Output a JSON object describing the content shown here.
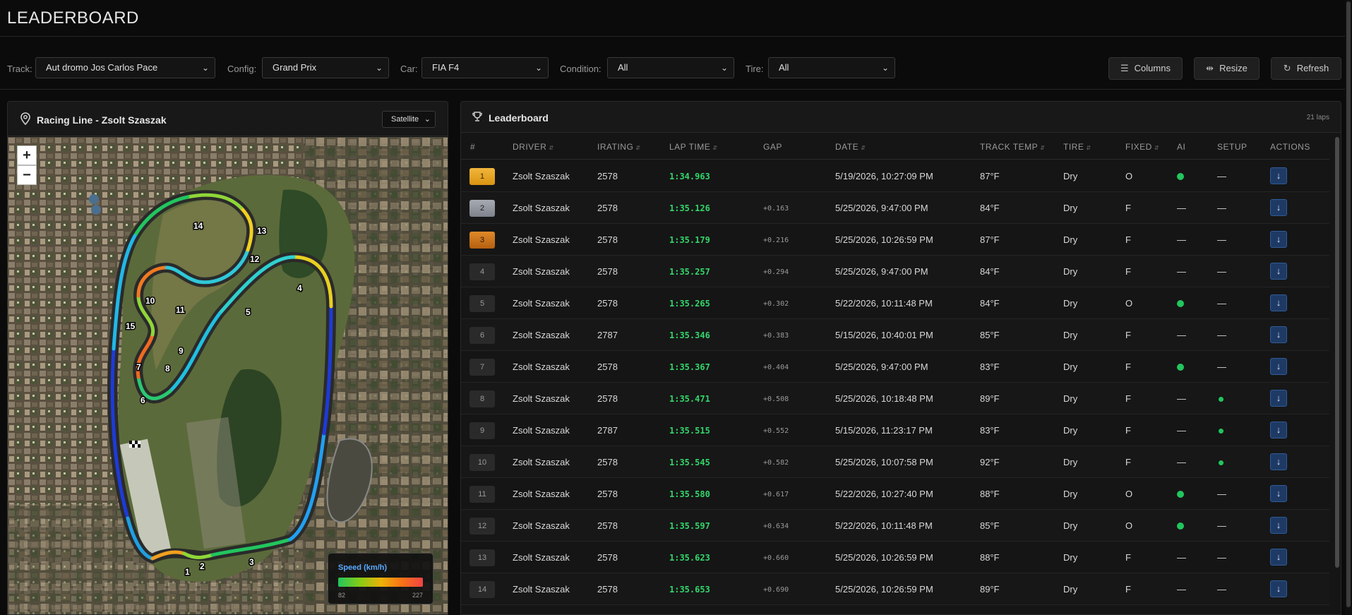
{
  "header": {
    "title": "LEADERBOARD"
  },
  "filters": {
    "track_label": "Track:",
    "track_value": "Aut dromo Jos Carlos Pace",
    "config_label": "Config:",
    "config_value": "Grand Prix",
    "car_label": "Car:",
    "car_value": "FIA F4",
    "condition_label": "Condition:",
    "condition_value": "All",
    "tire_label": "Tire:",
    "tire_value": "All"
  },
  "toolbar": {
    "columns": "Columns",
    "resize": "Resize",
    "refresh": "Refresh"
  },
  "map": {
    "title": "Racing Line - Zsolt Szaszak",
    "mode": "Satellite",
    "zoom_in": "+",
    "zoom_out": "−",
    "legend_title": "Speed (km/h)",
    "legend_min": "82",
    "legend_max": "227",
    "turns": [
      "1",
      "2",
      "3",
      "4",
      "5",
      "6",
      "7",
      "8",
      "9",
      "10",
      "11",
      "12",
      "13",
      "14",
      "15"
    ]
  },
  "leaderboard": {
    "title": "Leaderboard",
    "count": "21 laps",
    "columns": [
      "#",
      "DRIVER",
      "IRATING",
      "LAP TIME",
      "GAP",
      "DATE",
      "TRACK TEMP",
      "TIRE",
      "FIXED",
      "AI",
      "SETUP",
      "ACTIONS"
    ],
    "rows": [
      {
        "pos": "1",
        "driver": "Zsolt Szaszak",
        "irating": "2578",
        "lap": "1:34.963",
        "gap": "",
        "date": "5/19/2026, 10:27:09 PM",
        "temp": "87°F",
        "tire": "Dry",
        "fixed": "O",
        "ai": true,
        "setup": false
      },
      {
        "pos": "2",
        "driver": "Zsolt Szaszak",
        "irating": "2578",
        "lap": "1:35.126",
        "gap": "+0.163",
        "date": "5/25/2026, 9:47:00 PM",
        "temp": "84°F",
        "tire": "Dry",
        "fixed": "F",
        "ai": false,
        "setup": false
      },
      {
        "pos": "3",
        "driver": "Zsolt Szaszak",
        "irating": "2578",
        "lap": "1:35.179",
        "gap": "+0.216",
        "date": "5/25/2026, 10:26:59 PM",
        "temp": "87°F",
        "tire": "Dry",
        "fixed": "F",
        "ai": false,
        "setup": false
      },
      {
        "pos": "4",
        "driver": "Zsolt Szaszak",
        "irating": "2578",
        "lap": "1:35.257",
        "gap": "+0.294",
        "date": "5/25/2026, 9:47:00 PM",
        "temp": "84°F",
        "tire": "Dry",
        "fixed": "F",
        "ai": false,
        "setup": false
      },
      {
        "pos": "5",
        "driver": "Zsolt Szaszak",
        "irating": "2578",
        "lap": "1:35.265",
        "gap": "+0.302",
        "date": "5/22/2026, 10:11:48 PM",
        "temp": "84°F",
        "tire": "Dry",
        "fixed": "O",
        "ai": true,
        "setup": false
      },
      {
        "pos": "6",
        "driver": "Zsolt Szaszak",
        "irating": "2787",
        "lap": "1:35.346",
        "gap": "+0.383",
        "date": "5/15/2026, 10:40:01 PM",
        "temp": "85°F",
        "tire": "Dry",
        "fixed": "F",
        "ai": false,
        "setup": false
      },
      {
        "pos": "7",
        "driver": "Zsolt Szaszak",
        "irating": "2578",
        "lap": "1:35.367",
        "gap": "+0.404",
        "date": "5/25/2026, 9:47:00 PM",
        "temp": "83°F",
        "tire": "Dry",
        "fixed": "F",
        "ai": true,
        "setup": false
      },
      {
        "pos": "8",
        "driver": "Zsolt Szaszak",
        "irating": "2578",
        "lap": "1:35.471",
        "gap": "+0.508",
        "date": "5/25/2026, 10:18:48 PM",
        "temp": "89°F",
        "tire": "Dry",
        "fixed": "F",
        "ai": false,
        "setup": true
      },
      {
        "pos": "9",
        "driver": "Zsolt Szaszak",
        "irating": "2787",
        "lap": "1:35.515",
        "gap": "+0.552",
        "date": "5/15/2026, 11:23:17 PM",
        "temp": "83°F",
        "tire": "Dry",
        "fixed": "F",
        "ai": false,
        "setup": true
      },
      {
        "pos": "10",
        "driver": "Zsolt Szaszak",
        "irating": "2578",
        "lap": "1:35.545",
        "gap": "+0.582",
        "date": "5/25/2026, 10:07:58 PM",
        "temp": "92°F",
        "tire": "Dry",
        "fixed": "F",
        "ai": false,
        "setup": true
      },
      {
        "pos": "11",
        "driver": "Zsolt Szaszak",
        "irating": "2578",
        "lap": "1:35.580",
        "gap": "+0.617",
        "date": "5/22/2026, 10:27:40 PM",
        "temp": "88°F",
        "tire": "Dry",
        "fixed": "O",
        "ai": true,
        "setup": false
      },
      {
        "pos": "12",
        "driver": "Zsolt Szaszak",
        "irating": "2578",
        "lap": "1:35.597",
        "gap": "+0.634",
        "date": "5/22/2026, 10:11:48 PM",
        "temp": "85°F",
        "tire": "Dry",
        "fixed": "O",
        "ai": true,
        "setup": false
      },
      {
        "pos": "13",
        "driver": "Zsolt Szaszak",
        "irating": "2578",
        "lap": "1:35.623",
        "gap": "+0.660",
        "date": "5/25/2026, 10:26:59 PM",
        "temp": "88°F",
        "tire": "Dry",
        "fixed": "F",
        "ai": false,
        "setup": false
      },
      {
        "pos": "14",
        "driver": "Zsolt Szaszak",
        "irating": "2578",
        "lap": "1:35.653",
        "gap": "+0.690",
        "date": "5/25/2026, 10:26:59 PM",
        "temp": "89°F",
        "tire": "Dry",
        "fixed": "F",
        "ai": false,
        "setup": false
      }
    ],
    "dash": "—",
    "action_icon": "↓"
  },
  "colors": {
    "accent": "#33d66b",
    "gold": "#f2b63b",
    "silver": "#9ca0a8",
    "bronze": "#d07a22",
    "action": "#1e3a64"
  }
}
